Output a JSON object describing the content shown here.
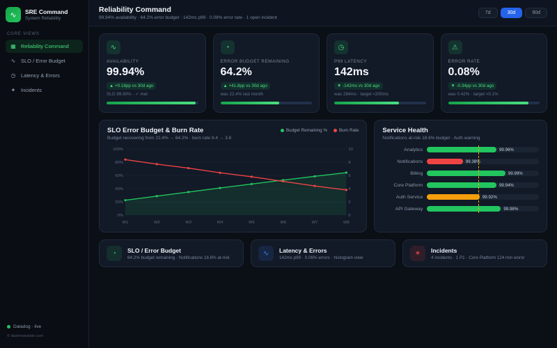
{
  "theme": {
    "green": "#22c55e",
    "red": "#ef4444",
    "amber": "#f59e0b",
    "blue": "#2563eb",
    "yellow": "#eab308"
  },
  "sidebar": {
    "brand": {
      "title": "SRE Command",
      "subtitle": "System Reliability"
    },
    "section_label": "CORE VIEWS",
    "items": [
      {
        "label": "Reliability Command",
        "icon": "bar-chart",
        "active": true
      },
      {
        "label": "SLO / Error Budget",
        "icon": "trend",
        "active": false
      },
      {
        "label": "Latency & Errors",
        "icon": "clock",
        "active": false
      },
      {
        "label": "Incidents",
        "icon": "spark",
        "active": false
      }
    ],
    "footer": {
      "status": "Datadog · live",
      "copyright": "© dashmaestate.com"
    }
  },
  "header": {
    "title": "Reliability Command",
    "subtitle": "99.94% availability · 64.2% error budget · 142ms p99 · 0.08% error rate · 1 open incident",
    "ranges": [
      {
        "label": "7d",
        "active": false
      },
      {
        "label": "30d",
        "active": true
      },
      {
        "label": "90d",
        "active": false
      }
    ]
  },
  "kpis": [
    {
      "label": "AVAILABILITY",
      "value": "99.94%",
      "arrow": "▲",
      "badge": "+0.18pp vs 30d ago",
      "note": "SLO 99.90% · ✓ met",
      "icon": "activity",
      "progress": 97
    },
    {
      "label": "ERROR BUDGET REMAINING",
      "value": "64.2%",
      "arrow": "▲",
      "badge": "+41.8pp vs 30d ago",
      "note": "was 22.4% last month",
      "icon": "gauge",
      "progress": 64
    },
    {
      "label": "P99 LATENCY",
      "value": "142ms",
      "arrow": "▼",
      "badge": "-142ms vs 30d ago",
      "note": "was 284ms · target <200ms",
      "icon": "clock",
      "progress": 71
    },
    {
      "label": "ERROR RATE",
      "value": "0.08%",
      "arrow": "▼",
      "badge": "-0.34pp vs 30d ago",
      "note": "was 0.42% · target <0.1%",
      "icon": "alert",
      "progress": 88
    }
  ],
  "chart_data": [
    {
      "type": "line",
      "title": "SLO Error Budget & Burn Rate",
      "subtitle": "Budget recovering from 22.4% → 64.2% · burn rate 8.4 → 3.8",
      "x": [
        "W1",
        "W2",
        "W3",
        "W4",
        "W5",
        "W6",
        "W7",
        "W8"
      ],
      "series": [
        {
          "name": "Budget Remaining %",
          "color": "#22c55e",
          "axis": "left",
          "area": true,
          "values": [
            22.4,
            28.6,
            34.8,
            41.0,
            46.9,
            52.8,
            58.6,
            64.2
          ]
        },
        {
          "name": "Burn Rate",
          "color": "#ef4444",
          "axis": "right",
          "area": false,
          "values": [
            8.4,
            7.7,
            7.1,
            6.4,
            5.8,
            5.1,
            4.4,
            3.8
          ]
        }
      ],
      "left_axis": {
        "min": 0,
        "max": 100,
        "ticks": [
          "0%",
          "20%",
          "40%",
          "60%",
          "80%",
          "100%"
        ]
      },
      "right_axis": {
        "min": 0,
        "max": 10,
        "ticks": [
          "0",
          "2",
          "4",
          "6",
          "8",
          "10"
        ]
      },
      "grid": true,
      "legend_position": "top-right"
    },
    {
      "type": "bar",
      "orientation": "horizontal",
      "title": "Service Health",
      "subtitle": "Notifications at-risk 18.6% budget · Auth warning",
      "categories": [
        "Analytics",
        "Notifications",
        "Billing",
        "Core Platform",
        "Auth Service",
        "API Gateway"
      ],
      "values": [
        99.96,
        99.38,
        99.99,
        99.94,
        99.92,
        99.98
      ],
      "value_labels": [
        "99.96%",
        "99.38%",
        "99.99%",
        "99.94%",
        "99.92%",
        "99.98%"
      ],
      "colors": [
        "#22c55e",
        "#ef4444",
        "#22c55e",
        "#22c55e",
        "#f59e0b",
        "#22c55e"
      ],
      "bar_pct": [
        62,
        32,
        70,
        62,
        47,
        66
      ],
      "target_pct": 46,
      "target_color": "#eab308"
    }
  ],
  "shortcuts": [
    {
      "title": "SLO / Error Budget",
      "subtitle": "64.2% budget remaining · Notifications 18.6% at-risk",
      "icon": "gauge",
      "color": "#22c55e"
    },
    {
      "title": "Latency & Errors",
      "subtitle": "142ms p99 · 0.06% errors · histogram view",
      "icon": "activity",
      "color": "#3b82f6"
    },
    {
      "title": "Incidents",
      "subtitle": "4 incidents · 1 P1 · Core Platform 124 min worst",
      "icon": "star",
      "color": "#ef4444"
    }
  ]
}
